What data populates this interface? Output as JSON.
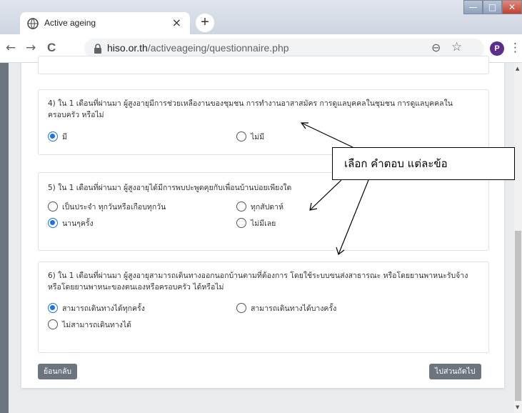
{
  "browser": {
    "tab_title": "Active ageing",
    "tab_close": "×",
    "new_tab": "+",
    "url_host": "hiso.or.th",
    "url_path": "/activeageing/questionnaire.php",
    "profile_initial": "P",
    "window_minimize": "—",
    "window_maximize": "□",
    "window_close": "✕",
    "back": "←",
    "forward": "→",
    "reload": "C",
    "zoom_icon": "⊖",
    "star_icon": "☆",
    "menu_icon": "⋮"
  },
  "questions": [
    {
      "text": "4) ใน 1 เดือนที่ผ่านมา ผู้สูงอายุมีการช่วยเหลืองานของชุมชน การทำงานอาสาสมัคร การดูแลบุคคลในชุมชน การดูแลบุคคลในครอบครัว หรือไม่",
      "options": [
        {
          "label": "มี",
          "selected": true
        },
        {
          "label": "ไม่มี",
          "selected": false
        }
      ]
    },
    {
      "text": "5) ใน 1 เดือนที่ผ่านมา ผู้สูงอายุได้มีการพบปะพูดคุยกับเพื่อนบ้านบ่อยเพียงใด",
      "options": [
        {
          "label": "เป็นประจำ ทุกวันหรือเกือบทุกวัน",
          "selected": false
        },
        {
          "label": "ทุกสัปดาห์",
          "selected": false
        },
        {
          "label": "นานๆครั้ง",
          "selected": true
        },
        {
          "label": "ไม่มีเลย",
          "selected": false
        }
      ]
    },
    {
      "text": "6) ใน 1 เดือนที่ผ่านมา ผู้สูงอายุสามารถเดินทางออกนอกบ้านตามที่ต้องการ โดยใช้ระบบขนส่งสาธารณะ หรือโดยยานพาหนะรับจ้าง หรือโดยยานพาหนะของตนเองหรือครอบครัว ได้หรือไม่",
      "options": [
        {
          "label": "สามารถเดินทางได้ทุกครั้ง",
          "selected": true
        },
        {
          "label": "สามารถเดินทางได้บางครั้ง",
          "selected": false
        },
        {
          "label": "ไม่สามารถเดินทางได้",
          "selected": false
        }
      ]
    }
  ],
  "buttons": {
    "back": "ย้อนกลับ",
    "next": "ไปส่วนถัดไป"
  },
  "annotation": "เลือก คำตอบ แต่ละข้อ",
  "colors": {
    "radio_selected": "#1a73e8",
    "button_bg": "#6c757d"
  }
}
